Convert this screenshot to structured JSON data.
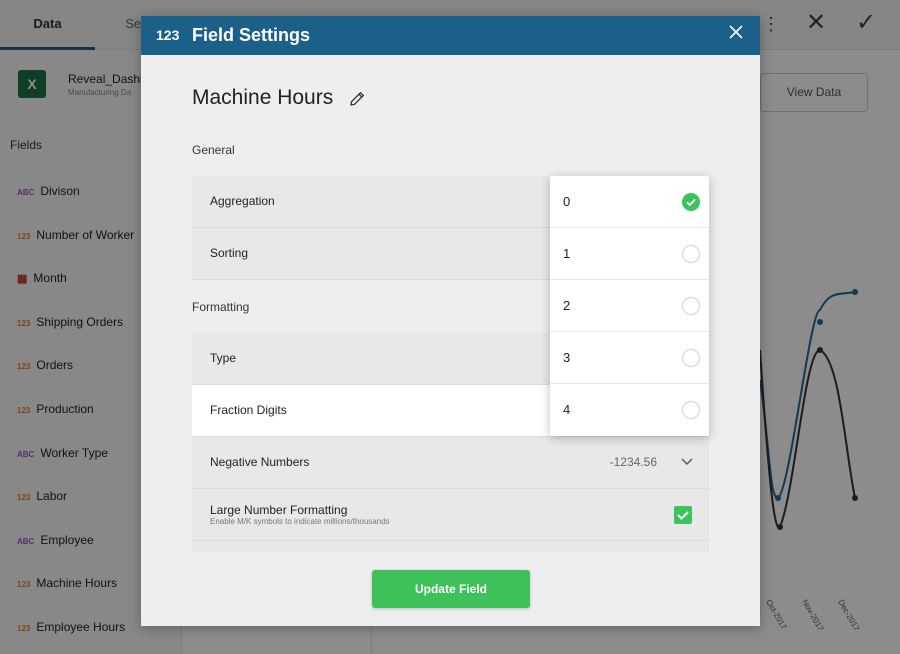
{
  "background": {
    "tabs": [
      "Data",
      "Set"
    ],
    "file": {
      "name": "Reveal_Dashb",
      "subtitle": "Manufacturing Da"
    },
    "fields_title": "Fields",
    "fields": [
      {
        "icon": "ABC",
        "type": "abc",
        "label": "Divison"
      },
      {
        "icon": "123",
        "type": "num",
        "label": "Number of Worker"
      },
      {
        "icon": "calendar",
        "type": "cal",
        "label": "Month"
      },
      {
        "icon": "123",
        "type": "num",
        "label": "Shipping Orders"
      },
      {
        "icon": "123",
        "type": "num",
        "label": "Orders"
      },
      {
        "icon": "123",
        "type": "num",
        "label": "Production"
      },
      {
        "icon": "ABC",
        "type": "abc",
        "label": "Worker Type"
      },
      {
        "icon": "123",
        "type": "num",
        "label": "Labor"
      },
      {
        "icon": "ABC",
        "type": "abc",
        "label": "Employee"
      },
      {
        "icon": "123",
        "type": "num",
        "label": "Machine Hours"
      },
      {
        "icon": "123",
        "type": "num",
        "label": "Employee Hours"
      }
    ],
    "view_data_label": "View Data",
    "chart_x_labels": [
      "Oct-2017",
      "Nov-2017",
      "Dec-2017"
    ]
  },
  "modal": {
    "type_icon": "123",
    "title": "Field Settings",
    "close_icon": "close-icon",
    "field_name": "Machine Hours",
    "sections": {
      "general": "General",
      "formatting": "Formatting"
    },
    "rows": {
      "aggregation": "Aggregation",
      "sorting": "Sorting",
      "type": "Type",
      "fraction_digits": "Fraction Digits",
      "negative_numbers": "Negative Numbers",
      "negative_numbers_value": "-1234.56",
      "large_number_formatting": "Large Number Formatting",
      "large_number_formatting_sub": "Enable M/K symbols to indicate millions/thousands"
    },
    "large_number_checked": true,
    "update_button": "Update Field"
  },
  "dropdown": {
    "options": [
      "0",
      "1",
      "2",
      "3",
      "4"
    ],
    "selected": "0"
  },
  "colors": {
    "header": "#1b6088",
    "accent_green": "#3cc45c"
  }
}
